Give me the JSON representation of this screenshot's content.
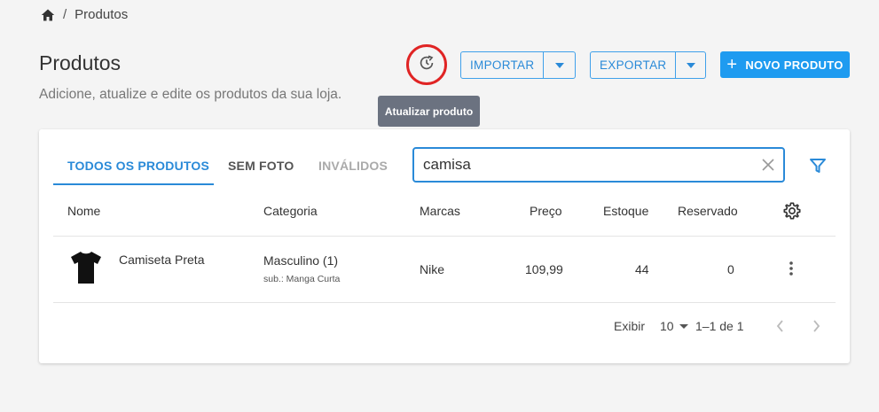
{
  "breadcrumb": {
    "home_icon": "home-icon",
    "separator": "/",
    "current": "Produtos"
  },
  "header": {
    "title": "Produtos",
    "subtitle": "Adicione, atualize e edite os produtos da sua loja.",
    "refresh_icon": "refresh-icon",
    "tooltip": "Atualizar produto",
    "import_label": "IMPORTAR",
    "export_label": "EXPORTAR",
    "new_product_label": "NOVO PRODUTO",
    "accent_color": "#1e9bf0",
    "highlight_color": "#e02424"
  },
  "tabs": [
    {
      "label": "TODOS OS PRODUTOS",
      "active": true
    },
    {
      "label": "SEM FOTO",
      "active": false
    },
    {
      "label": "INVÁLIDOS",
      "active": false
    }
  ],
  "search": {
    "value": "camisa",
    "placeholder": ""
  },
  "table": {
    "columns": [
      "Nome",
      "Categoria",
      "Marcas",
      "Preço",
      "Estoque",
      "Reservado"
    ],
    "rows": [
      {
        "name": "Camiseta Preta",
        "category": "Masculino (1)",
        "subcategory": "sub.: Manga Curta",
        "brand": "Nike",
        "price": "109,99",
        "stock": "44",
        "reserved": "0",
        "image_icon": "tshirt-icon"
      }
    ]
  },
  "pagination": {
    "show_label": "Exibir",
    "per_page": "10",
    "range": "1–1 de 1"
  }
}
